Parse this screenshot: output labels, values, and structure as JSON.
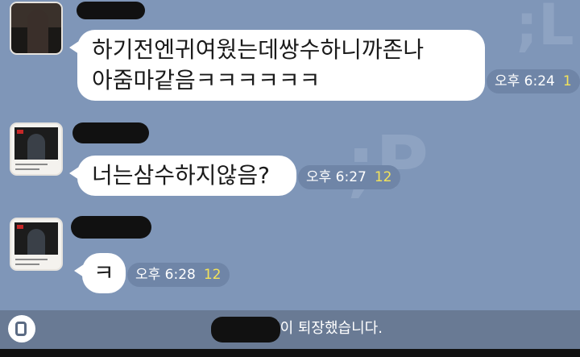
{
  "messages": [
    {
      "lines": [
        "하기전엔귀여웠는데쌍수하니까존나",
        "아줌마같음ㅋㅋㅋㅋㅋㅋ"
      ],
      "time": "오후 6:24",
      "count": "1"
    },
    {
      "lines": [
        "너는삼수하지않음?"
      ],
      "time": "오후 6:27",
      "count": "12"
    },
    {
      "lines": [
        "ㅋ"
      ],
      "time": "오후 6:28",
      "count": "12"
    }
  ],
  "notice": {
    "text": "님이 퇴장했습니다."
  },
  "colors": {
    "background": "#7f96b8",
    "bubble": "#ffffff",
    "unread_count": "#f3e35a",
    "notice_bar": "#697a94"
  },
  "icons": {
    "notice": "exit-door-icon"
  }
}
